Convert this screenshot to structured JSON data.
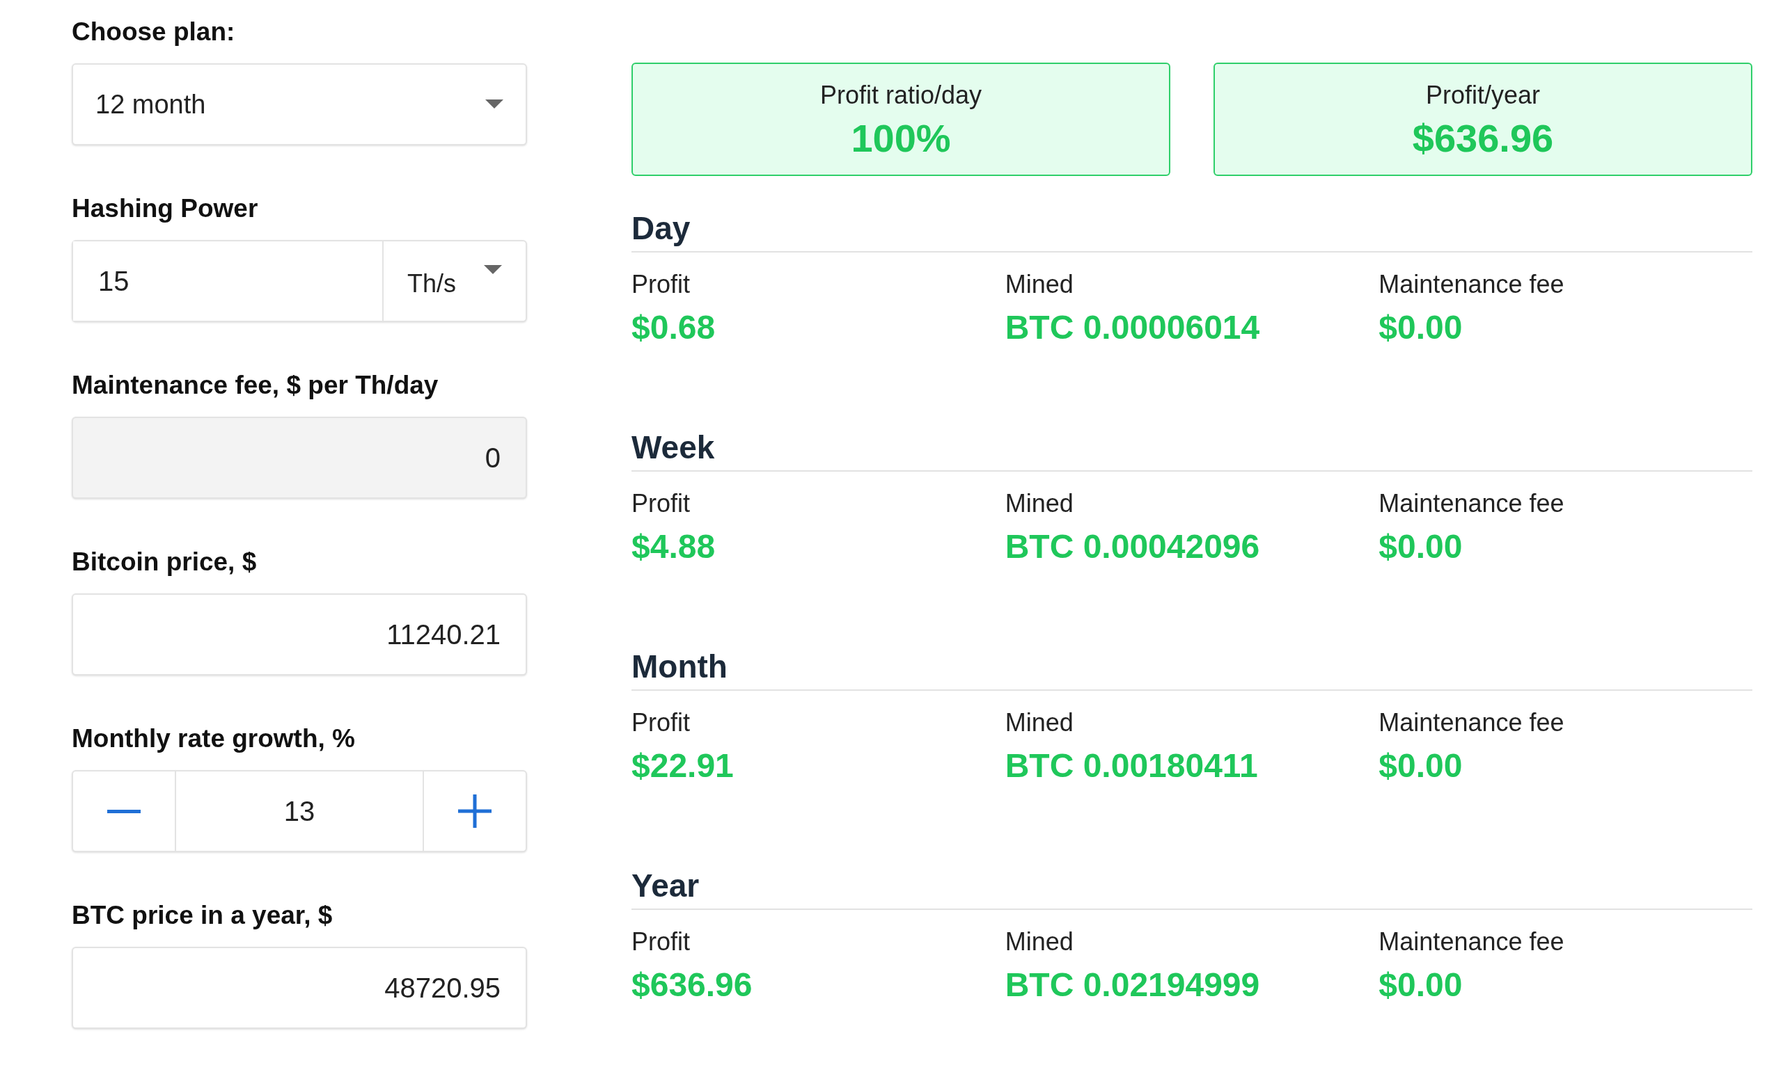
{
  "form": {
    "plan": {
      "label": "Choose plan:",
      "value": "12 month"
    },
    "hashing_power": {
      "label": "Hashing Power",
      "value": "15",
      "unit": "Th/s"
    },
    "maintenance_fee": {
      "label": "Maintenance fee, $ per Th/day",
      "value": "0",
      "disabled": true
    },
    "bitcoin_price": {
      "label": "Bitcoin price, $",
      "value": "11240.21",
      "disabled": false
    },
    "monthly_rate_growth": {
      "label": "Monthly rate growth, %",
      "value": "13"
    },
    "btc_price_in_a_year": {
      "label": "BTC price in a year, $",
      "value": "48720.95",
      "disabled": false
    }
  },
  "summary": [
    {
      "label": "Profit ratio/day",
      "value": "100%"
    },
    {
      "label": "Profit/year",
      "value": "$636.96"
    }
  ],
  "periods": [
    {
      "title": "Day",
      "columns": [
        {
          "label": "Profit",
          "value": "$0.68"
        },
        {
          "label": "Mined",
          "value": "BTC 0.00006014"
        },
        {
          "label": "Maintenance fee",
          "value": "$0.00"
        }
      ]
    },
    {
      "title": "Week",
      "columns": [
        {
          "label": "Profit",
          "value": "$4.88"
        },
        {
          "label": "Mined",
          "value": "BTC 0.00042096"
        },
        {
          "label": "Maintenance fee",
          "value": "$0.00"
        }
      ]
    },
    {
      "title": "Month",
      "columns": [
        {
          "label": "Profit",
          "value": "$22.91"
        },
        {
          "label": "Mined",
          "value": "BTC 0.00180411"
        },
        {
          "label": "Maintenance fee",
          "value": "$0.00"
        }
      ]
    },
    {
      "title": "Year",
      "columns": [
        {
          "label": "Profit",
          "value": "$636.96"
        },
        {
          "label": "Mined",
          "value": "BTC 0.02194999"
        },
        {
          "label": "Maintenance fee",
          "value": "$0.00"
        }
      ]
    }
  ]
}
